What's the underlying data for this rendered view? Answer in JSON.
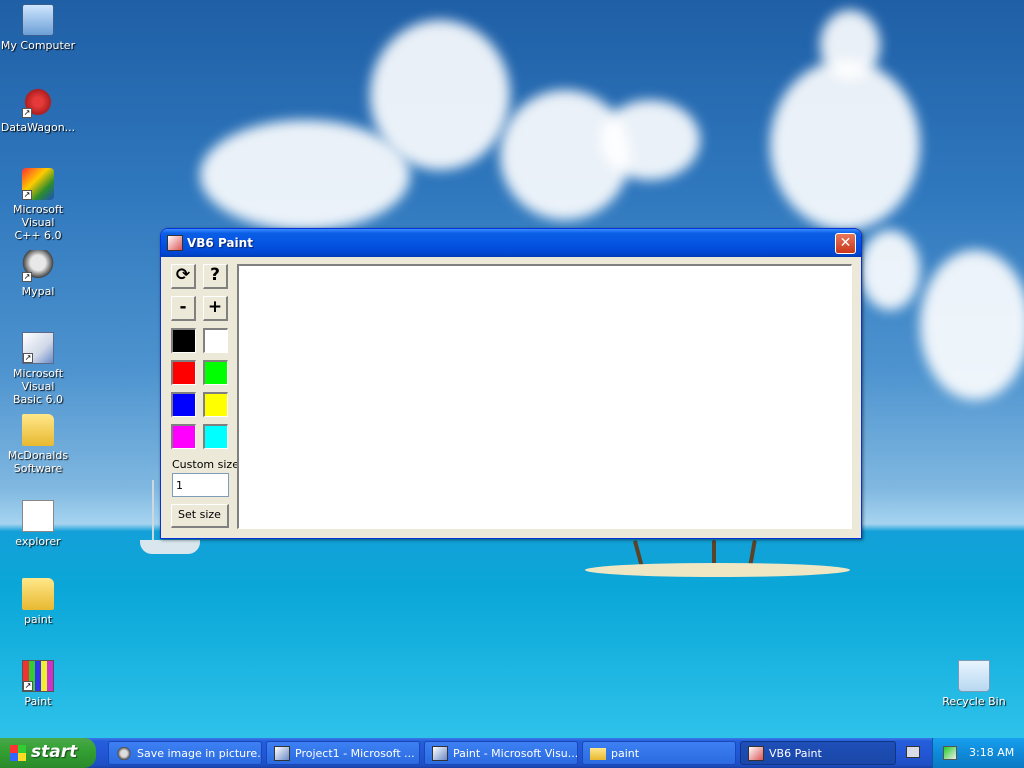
{
  "desktop": {
    "icons": [
      {
        "label": "My Computer"
      },
      {
        "label": "DataWagon..."
      },
      {
        "label": "Microsoft Visual\nC++ 6.0"
      },
      {
        "label": "Mypal"
      },
      {
        "label": "Microsoft Visual\nBasic 6.0"
      },
      {
        "label": "McDonalds\nSoftware"
      },
      {
        "label": "explorer"
      },
      {
        "label": "paint"
      },
      {
        "label": "Paint"
      },
      {
        "label": "Recycle Bin"
      }
    ]
  },
  "window": {
    "title": "VB6 Paint",
    "close_label": "✕",
    "tools": {
      "refresh_symbol": "⟳",
      "help_symbol": "?",
      "decrease_symbol": "-",
      "increase_symbol": "+"
    },
    "colors": {
      "black": "#000000",
      "white": "#ffffff",
      "red": "#ff0000",
      "green": "#00ff00",
      "blue": "#0000ff",
      "yellow": "#ffff00",
      "magenta": "#ff00ff",
      "cyan": "#00ffff"
    },
    "custom_size_label": "Custom size:",
    "size_value": "1",
    "set_size_label": "Set size"
  },
  "taskbar": {
    "start_label": "start",
    "tasks": [
      {
        "label": "Save image in picture..."
      },
      {
        "label": "Project1 - Microsoft ..."
      },
      {
        "label": "Paint - Microsoft Visu..."
      },
      {
        "label": "paint"
      },
      {
        "label": "VB6 Paint"
      }
    ],
    "clock": "3:18 AM"
  }
}
